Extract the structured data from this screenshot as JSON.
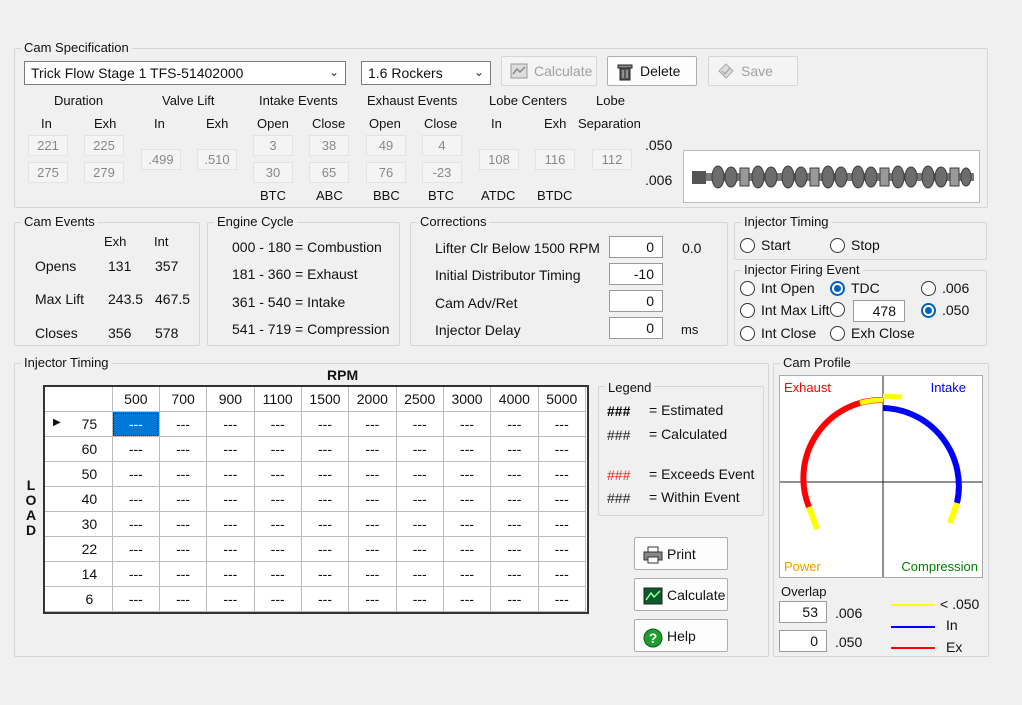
{
  "cam_spec": {
    "title": "Cam Specification",
    "cam_selected": "Trick Flow Stage 1 TFS-51402000",
    "rocker_selected": "1.6 Rockers",
    "calculate_label": "Calculate",
    "delete_label": "Delete",
    "save_label": "Save",
    "headers": {
      "duration": "Duration",
      "valve_lift": "Valve Lift",
      "intake_events": "Intake Events",
      "exhaust_events": "Exhaust Events",
      "lobe_centers": "Lobe Centers",
      "lobe": "Lobe"
    },
    "subheaders": {
      "dur_in": "In",
      "dur_exh": "Exh",
      "lift_in": "In",
      "lift_exh": "Exh",
      "int_open": "Open",
      "int_close": "Close",
      "exh_open": "Open",
      "exh_close": "Close",
      "lc_in": "In",
      "lc_exh": "Exh",
      "separation": "Separation"
    },
    "row050_label": ".050",
    "row006_label": ".006",
    "duration_in_050": "221",
    "duration_exh_050": "225",
    "duration_in_006": "275",
    "duration_exh_006": "279",
    "lift_in": ".499",
    "lift_exh": ".510",
    "int_open_050": "3",
    "int_close_050": "38",
    "int_open_006": "30",
    "int_close_006": "65",
    "exh_open_050": "49",
    "exh_close_050": "4",
    "exh_open_006": "76",
    "exh_close_006": "-23",
    "lc_in": "108",
    "lc_exh": "116",
    "separation": "112",
    "footers": {
      "btc1": "BTC",
      "abc": "ABC",
      "bbc": "BBC",
      "btc2": "BTC",
      "atdc": "ATDC",
      "btdc": "BTDC"
    }
  },
  "cam_events": {
    "title": "Cam Events",
    "col_exh": "Exh",
    "col_int": "Int",
    "rows": [
      {
        "label": "Opens",
        "exh": "131",
        "int": "357"
      },
      {
        "label": "Max Lift",
        "exh": "243.5",
        "int": "467.5"
      },
      {
        "label": "Closes",
        "exh": "356",
        "int": "578"
      }
    ]
  },
  "engine_cycle": {
    "title": "Engine Cycle",
    "lines": [
      "000 - 180 = Combustion",
      "181 - 360 = Exhaust",
      "361 - 540 = Intake",
      "541 - 719 = Compression"
    ]
  },
  "corrections": {
    "title": "Corrections",
    "lifter_label": "Lifter Clr Below 1500 RPM",
    "lifter_value": "0",
    "lifter_extra": "0.0",
    "timing_label": "Initial Distributor Timing",
    "timing_value": "-10",
    "cam_label": "Cam Adv/Ret",
    "cam_value": "0",
    "injector_label": "Injector Delay",
    "injector_value": "0",
    "injector_unit": "ms"
  },
  "injector_timing_mode": {
    "title": "Injector  Timing",
    "start_label": "Start",
    "stop_label": "Stop"
  },
  "injector_firing": {
    "title": "Injector Firing Event",
    "int_open": "Int Open",
    "tdc": "TDC",
    "opt006": ".006",
    "int_max_lift": "Int Max Lift",
    "custom_value": "478",
    "opt050": ".050",
    "int_close": "Int Close",
    "exh_close": "Exh Close"
  },
  "injector_table": {
    "title": "Injector Timing",
    "rpm_label": "RPM",
    "load_label": [
      "L",
      "O",
      "A",
      "D"
    ],
    "rpm": [
      "500",
      "700",
      "900",
      "1100",
      "1500",
      "2000",
      "2500",
      "3000",
      "4000",
      "5000"
    ],
    "load": [
      "75",
      "60",
      "50",
      "40",
      "30",
      "22",
      "14",
      "6"
    ],
    "cell_value": "---"
  },
  "legend": {
    "title": "Legend",
    "mark": "###",
    "estimated": "= Estimated",
    "calculated": "= Calculated",
    "exceeds": "= Exceeds Event",
    "within": "=  Within Event"
  },
  "actions": {
    "print": "Print",
    "calculate": "Calculate",
    "help": "Help"
  },
  "cam_profile": {
    "title": "Cam Profile",
    "exhaust": "Exhaust",
    "intake": "Intake",
    "power": "Power",
    "compression": "Compression",
    "overlap_label": "Overlap",
    "overlap_006": "53",
    "overlap_050": "0",
    "label_006": ".006",
    "label_050": ".050",
    "key_lt050": "< .050",
    "key_in": "In",
    "key_ex": "Ex",
    "colors": {
      "exhaust": "#ff0000",
      "intake": "#0000ff",
      "lift": "#ffff00",
      "power": "#ff9900",
      "compression": "#008000"
    }
  }
}
